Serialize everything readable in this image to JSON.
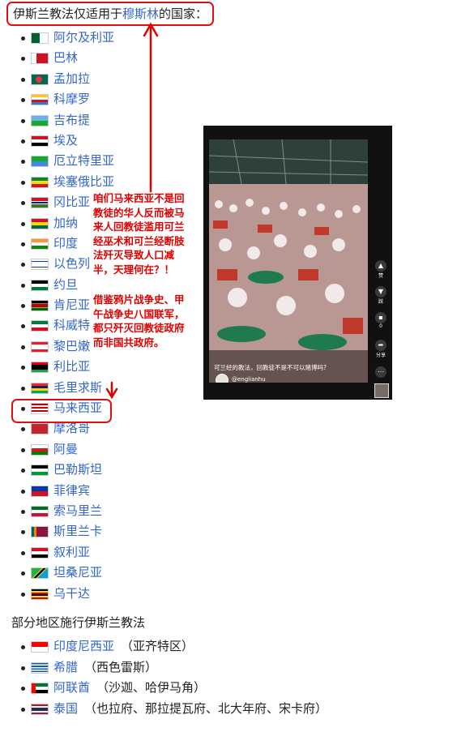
{
  "heading": {
    "prefix": "伊斯兰教法仅适用于",
    "link": "穆斯林",
    "suffix": "的国家："
  },
  "countries": [
    {
      "name": "阿尔及利亚",
      "flag": "algeria"
    },
    {
      "name": "巴林",
      "flag": "bahrain"
    },
    {
      "name": "孟加拉",
      "flag": "bangladesh"
    },
    {
      "name": "科摩罗",
      "flag": "comoros"
    },
    {
      "name": "吉布提",
      "flag": "djibouti"
    },
    {
      "name": "埃及",
      "flag": "egypt"
    },
    {
      "name": "厄立特里亚",
      "flag": "eritrea"
    },
    {
      "name": "埃塞俄比亚",
      "flag": "ethiopia"
    },
    {
      "name": "冈比亚",
      "flag": "gambia"
    },
    {
      "name": "加纳",
      "flag": "ghana"
    },
    {
      "name": "印度",
      "flag": "india"
    },
    {
      "name": "以色列",
      "flag": "israel"
    },
    {
      "name": "约旦",
      "flag": "jordan"
    },
    {
      "name": "肯尼亚",
      "flag": "kenya"
    },
    {
      "name": "科威特",
      "flag": "kuwait"
    },
    {
      "name": "黎巴嫩",
      "flag": "lebanon"
    },
    {
      "name": "利比亚",
      "flag": "libya"
    },
    {
      "name": "毛里求斯",
      "flag": "mauritius"
    },
    {
      "name": "马来西亚",
      "flag": "malaysia"
    },
    {
      "name": "摩洛哥",
      "flag": "morocco"
    },
    {
      "name": "阿曼",
      "flag": "oman"
    },
    {
      "name": "巴勒斯坦",
      "flag": "palestine"
    },
    {
      "name": "菲律宾",
      "flag": "philippines"
    },
    {
      "name": "索马里兰",
      "flag": "somaliland"
    },
    {
      "name": "斯里兰卡",
      "flag": "srilanka"
    },
    {
      "name": "叙利亚",
      "flag": "syria"
    },
    {
      "name": "坦桑尼亚",
      "flag": "tanzania"
    },
    {
      "name": "乌干达",
      "flag": "uganda"
    }
  ],
  "partial_heading": "部分地区施行伊斯兰教法",
  "partial": [
    {
      "name": "印度尼西亚",
      "note": "（亚齐特区）",
      "flag": "indonesia"
    },
    {
      "name": "希腊",
      "note": "（西色雷斯）",
      "flag": "greece"
    },
    {
      "name": "阿联酋",
      "note": "（沙迦、哈伊马角）",
      "flag": "uae"
    },
    {
      "name": "泰国",
      "note": "（也拉府、那拉提瓦府、北大年府、宋卡府）",
      "flag": "thailand"
    }
  ],
  "annotation_1": "咱们马来西亚不是回教徒的华人反而被马来人回教徒滥用可兰经巫术和可兰经断肢法歼灭导致人口减半，天理何在？！",
  "annotation_2": "借鉴鸦片战争史、甲午战争史八国联军，都只歼灭回教徒政府而非国共政府。",
  "video": {
    "caption": "可兰经的教法，回教徒不是不可以赌博吗?",
    "handle": "@englianhu",
    "side_labels": [
      "赞",
      "踩",
      "0",
      "分享"
    ]
  },
  "colors": {
    "annotation": "#e00000",
    "link": "#3366cc"
  }
}
